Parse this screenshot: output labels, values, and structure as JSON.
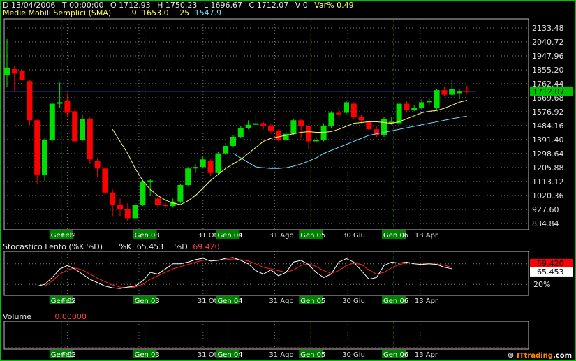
{
  "header": {
    "date": "D 13/04/2006",
    "time": "T 00:00:00",
    "open": "O 1712.93",
    "high": "H 1750.23",
    "low": "L 1696.67",
    "close": "C 1712.07",
    "volume": "V 0",
    "var": "Var% 0.49"
  },
  "sma": {
    "title": "Medie Mobili Semplici (SMA)",
    "p1_label": "9",
    "p1_value": "1653.0",
    "p2_label": "25",
    "p2_value": "1547.9"
  },
  "stoch": {
    "title": "Stocastico Lento (%K %D)",
    "k_label": "%K",
    "k_value": "65.453",
    "d_label": "%D",
    "d_value": "69.420",
    "level_label": "20%"
  },
  "volume": {
    "title": "Volume",
    "value": "0.00000"
  },
  "watermark": {
    "prefix": "© ",
    "brand": "ITtrading",
    "suffix": ".com"
  },
  "colors": {
    "up": "#00e000",
    "down": "#ff0000",
    "sma9": "#ffff66",
    "sma25": "#66e0ff",
    "stochK": "#ffffff",
    "stochD": "#ff2020",
    "price_line": "#4040ff"
  },
  "chart_data": {
    "type": "candlestick",
    "price_ticks": [
      "2133.48",
      "2040.72",
      "1947.96",
      "1855.20",
      "1762.44",
      "1669.68",
      "1576.92",
      "1484.16",
      "1391.40",
      "1298.64",
      "1205.88",
      "1113.12",
      "1020.36",
      "927.60",
      "834.84"
    ],
    "price_range": [
      834.84,
      2133.48
    ],
    "last_price": "1712.07",
    "date_labels": [
      {
        "text": "Gen 02",
        "x": 7.2,
        "highlight": true
      },
      {
        "text": "Feb",
        "x": 8,
        "highlight": false
      },
      {
        "text": "31",
        "x": 17.5,
        "highlight": false
      },
      {
        "text": "Gen 03",
        "x": 18.3,
        "highlight": true
      },
      {
        "text": "31 Ott",
        "x": 26,
        "highlight": false
      },
      {
        "text": "Gen 04",
        "x": 29.3,
        "highlight": true
      },
      {
        "text": "31 Ago",
        "x": 35.5,
        "highlight": false
      },
      {
        "text": "Gen 05",
        "x": 40.3,
        "highlight": true
      },
      {
        "text": "30 Giu",
        "x": 45.2,
        "highlight": false
      },
      {
        "text": "Gen 06",
        "x": 51.3,
        "highlight": true
      },
      {
        "text": "13 Apr",
        "x": 54.8,
        "highlight": false
      }
    ],
    "candles": [
      [
        1820,
        1870,
        2060,
        1740
      ],
      [
        1860,
        1830,
        1880,
        1710
      ],
      [
        1850,
        1790,
        1860,
        1700
      ],
      [
        1780,
        1520,
        1790,
        1490
      ],
      [
        1520,
        1160,
        1530,
        1100
      ],
      [
        1160,
        1390,
        1400,
        1120
      ],
      [
        1390,
        1630,
        1640,
        1370
      ],
      [
        1630,
        1640,
        1770,
        1600
      ],
      [
        1650,
        1570,
        1700,
        1540
      ],
      [
        1580,
        1380,
        1600,
        1370
      ],
      [
        1390,
        1530,
        1560,
        1380
      ],
      [
        1530,
        1260,
        1540,
        1230
      ],
      [
        1250,
        1200,
        1270,
        1140
      ],
      [
        1200,
        1040,
        1210,
        990
      ],
      [
        1040,
        960,
        1060,
        880
      ],
      [
        960,
        930,
        1000,
        880
      ],
      [
        930,
        870,
        970,
        850
      ],
      [
        870,
        960,
        980,
        840
      ],
      [
        960,
        1110,
        1120,
        950
      ],
      [
        1110,
        1120,
        1130,
        1020
      ],
      [
        1000,
        960,
        1010,
        940
      ],
      [
        960,
        950,
        980,
        930
      ],
      [
        950,
        980,
        1000,
        940
      ],
      [
        980,
        1090,
        1100,
        970
      ],
      [
        1090,
        1200,
        1210,
        1080
      ],
      [
        1200,
        1210,
        1230,
        1170
      ],
      [
        1210,
        1260,
        1280,
        1200
      ],
      [
        1250,
        1170,
        1260,
        1150
      ],
      [
        1170,
        1300,
        1310,
        1160
      ],
      [
        1300,
        1350,
        1370,
        1290
      ],
      [
        1350,
        1410,
        1420,
        1340
      ],
      [
        1410,
        1470,
        1480,
        1400
      ],
      [
        1470,
        1490,
        1520,
        1460
      ],
      [
        1490,
        1500,
        1560,
        1480
      ],
      [
        1500,
        1480,
        1510,
        1460
      ],
      [
        1480,
        1450,
        1500,
        1430
      ],
      [
        1450,
        1390,
        1460,
        1380
      ],
      [
        1390,
        1430,
        1450,
        1380
      ],
      [
        1430,
        1520,
        1530,
        1420
      ],
      [
        1520,
        1480,
        1530,
        1400
      ],
      [
        1480,
        1380,
        1490,
        1330
      ],
      [
        1380,
        1390,
        1410,
        1370
      ],
      [
        1390,
        1480,
        1500,
        1380
      ],
      [
        1480,
        1570,
        1580,
        1470
      ],
      [
        1570,
        1560,
        1600,
        1550
      ],
      [
        1570,
        1640,
        1650,
        1560
      ],
      [
        1630,
        1540,
        1640,
        1530
      ],
      [
        1540,
        1520,
        1560,
        1500
      ],
      [
        1510,
        1460,
        1520,
        1440
      ],
      [
        1460,
        1420,
        1480,
        1410
      ],
      [
        1420,
        1530,
        1540,
        1410
      ],
      [
        1500,
        1510,
        1540,
        1490
      ],
      [
        1500,
        1630,
        1640,
        1490
      ],
      [
        1630,
        1590,
        1650,
        1570
      ],
      [
        1590,
        1600,
        1620,
        1580
      ],
      [
        1600,
        1640,
        1660,
        1590
      ],
      [
        1640,
        1650,
        1670,
        1620
      ],
      [
        1600,
        1720,
        1730,
        1590
      ],
      [
        1720,
        1690,
        1740,
        1680
      ],
      [
        1690,
        1730,
        1790,
        1680
      ],
      [
        1700,
        1710,
        1730,
        1660
      ],
      [
        1712.93,
        1712.07,
        1750.23,
        1696.67
      ]
    ],
    "sma9": [
      [
        14,
        1460
      ],
      [
        15,
        1380
      ],
      [
        16,
        1300
      ],
      [
        17,
        1200
      ],
      [
        18,
        1120
      ],
      [
        19,
        1060
      ],
      [
        20,
        1020
      ],
      [
        21,
        990
      ],
      [
        22,
        970
      ],
      [
        23,
        960
      ],
      [
        24,
        985
      ],
      [
        25,
        1020
      ],
      [
        26,
        1070
      ],
      [
        27,
        1120
      ],
      [
        28,
        1160
      ],
      [
        29,
        1200
      ],
      [
        30,
        1230
      ],
      [
        31,
        1260
      ],
      [
        32,
        1300
      ],
      [
        33,
        1340
      ],
      [
        34,
        1380
      ],
      [
        35,
        1400
      ],
      [
        36,
        1410
      ],
      [
        37,
        1420
      ],
      [
        38,
        1430
      ],
      [
        39,
        1440
      ],
      [
        40,
        1445
      ],
      [
        41,
        1440
      ],
      [
        42,
        1440
      ],
      [
        43,
        1445
      ],
      [
        44,
        1460
      ],
      [
        45,
        1480
      ],
      [
        46,
        1500
      ],
      [
        47,
        1505
      ],
      [
        48,
        1510
      ],
      [
        49,
        1510
      ],
      [
        50,
        1505
      ],
      [
        51,
        1500
      ],
      [
        52,
        1510
      ],
      [
        53,
        1530
      ],
      [
        54,
        1550
      ],
      [
        55,
        1570
      ],
      [
        56,
        1580
      ],
      [
        57,
        1585
      ],
      [
        58,
        1600
      ],
      [
        59,
        1620
      ],
      [
        60,
        1640
      ],
      [
        61,
        1653
      ]
    ],
    "sma25": [
      [
        30,
        1300
      ],
      [
        31,
        1270
      ],
      [
        32,
        1240
      ],
      [
        33,
        1210
      ],
      [
        34,
        1205
      ],
      [
        35,
        1200
      ],
      [
        36,
        1200
      ],
      [
        37,
        1205
      ],
      [
        38,
        1215
      ],
      [
        39,
        1230
      ],
      [
        40,
        1250
      ],
      [
        41,
        1270
      ],
      [
        42,
        1300
      ],
      [
        43,
        1320
      ],
      [
        44,
        1340
      ],
      [
        45,
        1360
      ],
      [
        46,
        1380
      ],
      [
        47,
        1400
      ],
      [
        48,
        1420
      ],
      [
        49,
        1430
      ],
      [
        50,
        1440
      ],
      [
        51,
        1450
      ],
      [
        52,
        1460
      ],
      [
        53,
        1470
      ],
      [
        54,
        1480
      ],
      [
        55,
        1490
      ],
      [
        56,
        1500
      ],
      [
        57,
        1510
      ],
      [
        58,
        1520
      ],
      [
        59,
        1530
      ],
      [
        60,
        1540
      ],
      [
        61,
        1547.9
      ]
    ],
    "stoch_k": [
      [
        4,
        15
      ],
      [
        5,
        20
      ],
      [
        6,
        40
      ],
      [
        7,
        65
      ],
      [
        8,
        75
      ],
      [
        9,
        65
      ],
      [
        10,
        50
      ],
      [
        11,
        35
      ],
      [
        12,
        25
      ],
      [
        13,
        15
      ],
      [
        14,
        10
      ],
      [
        15,
        8
      ],
      [
        16,
        12
      ],
      [
        17,
        15
      ],
      [
        18,
        30
      ],
      [
        19,
        55
      ],
      [
        20,
        50
      ],
      [
        21,
        65
      ],
      [
        22,
        80
      ],
      [
        23,
        80
      ],
      [
        24,
        85
      ],
      [
        25,
        92
      ],
      [
        26,
        96
      ],
      [
        27,
        88
      ],
      [
        28,
        90
      ],
      [
        29,
        96
      ],
      [
        30,
        98
      ],
      [
        31,
        90
      ],
      [
        32,
        80
      ],
      [
        33,
        60
      ],
      [
        34,
        50
      ],
      [
        35,
        62
      ],
      [
        36,
        45
      ],
      [
        37,
        55
      ],
      [
        38,
        85
      ],
      [
        39,
        90
      ],
      [
        40,
        78
      ],
      [
        41,
        55
      ],
      [
        42,
        40
      ],
      [
        43,
        50
      ],
      [
        44,
        85
      ],
      [
        45,
        95
      ],
      [
        46,
        85
      ],
      [
        47,
        60
      ],
      [
        48,
        35
      ],
      [
        49,
        40
      ],
      [
        50,
        75
      ],
      [
        51,
        85
      ],
      [
        52,
        82
      ],
      [
        53,
        85
      ],
      [
        54,
        80
      ],
      [
        55,
        78
      ],
      [
        56,
        80
      ],
      [
        57,
        78
      ],
      [
        58,
        70
      ],
      [
        59,
        65.453
      ]
    ],
    "stoch_d": [
      [
        5,
        15
      ],
      [
        6,
        30
      ],
      [
        7,
        50
      ],
      [
        8,
        62
      ],
      [
        9,
        68
      ],
      [
        10,
        62
      ],
      [
        11,
        50
      ],
      [
        12,
        38
      ],
      [
        13,
        28
      ],
      [
        14,
        18
      ],
      [
        15,
        12
      ],
      [
        16,
        10
      ],
      [
        17,
        12
      ],
      [
        18,
        20
      ],
      [
        19,
        35
      ],
      [
        20,
        45
      ],
      [
        21,
        55
      ],
      [
        22,
        65
      ],
      [
        23,
        72
      ],
      [
        24,
        78
      ],
      [
        25,
        85
      ],
      [
        26,
        90
      ],
      [
        27,
        90
      ],
      [
        28,
        90
      ],
      [
        29,
        92
      ],
      [
        30,
        94
      ],
      [
        31,
        92
      ],
      [
        32,
        88
      ],
      [
        33,
        80
      ],
      [
        34,
        70
      ],
      [
        35,
        65
      ],
      [
        36,
        60
      ],
      [
        37,
        55
      ],
      [
        38,
        62
      ],
      [
        39,
        75
      ],
      [
        40,
        80
      ],
      [
        41,
        72
      ],
      [
        42,
        60
      ],
      [
        43,
        52
      ],
      [
        44,
        60
      ],
      [
        45,
        75
      ],
      [
        46,
        82
      ],
      [
        47,
        78
      ],
      [
        48,
        62
      ],
      [
        49,
        50
      ],
      [
        50,
        55
      ],
      [
        51,
        68
      ],
      [
        52,
        78
      ],
      [
        53,
        82
      ],
      [
        54,
        83
      ],
      [
        55,
        82
      ],
      [
        56,
        80
      ],
      [
        57,
        79
      ],
      [
        58,
        76
      ],
      [
        59,
        69.42
      ]
    ]
  }
}
